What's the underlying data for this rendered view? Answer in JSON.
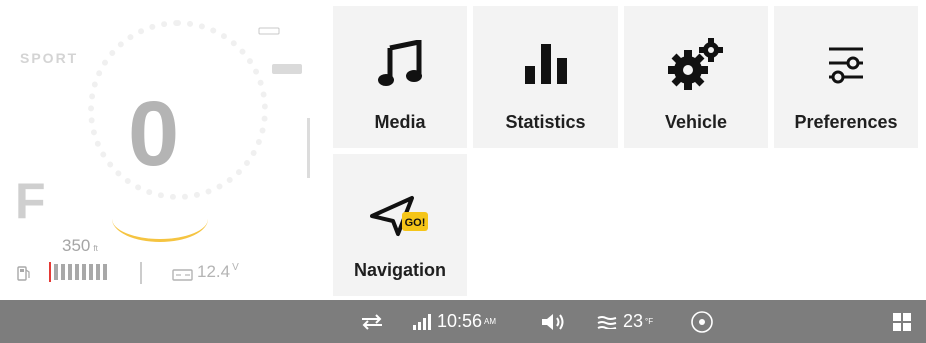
{
  "cluster": {
    "mode": "SPORT",
    "gear": "0",
    "fuel_letter": "F",
    "range_value": "350",
    "range_unit": "ft",
    "voltage_value": "12.4",
    "voltage_unit": "V",
    "fuel_level": 0.8,
    "throttle_color": "#f5c441",
    "fuel_cursor_color": "#e53935"
  },
  "menu": {
    "tiles": [
      {
        "label": "Media",
        "icon": "music-note-icon"
      },
      {
        "label": "Statistics",
        "icon": "bar-chart-icon"
      },
      {
        "label": "Vehicle",
        "icon": "gears-icon"
      },
      {
        "label": "Preferences",
        "icon": "sliders-icon"
      },
      {
        "label": "Navigation",
        "icon": "navigation-go-icon",
        "badge": "GO!"
      }
    ],
    "tile_bg": "#f3f3f3",
    "badge_color": "#f5c518"
  },
  "statusbar": {
    "time": "10:56",
    "ampm": "AM",
    "temperature": "23",
    "temp_unit": "°F",
    "background": "#7d7d7d"
  }
}
